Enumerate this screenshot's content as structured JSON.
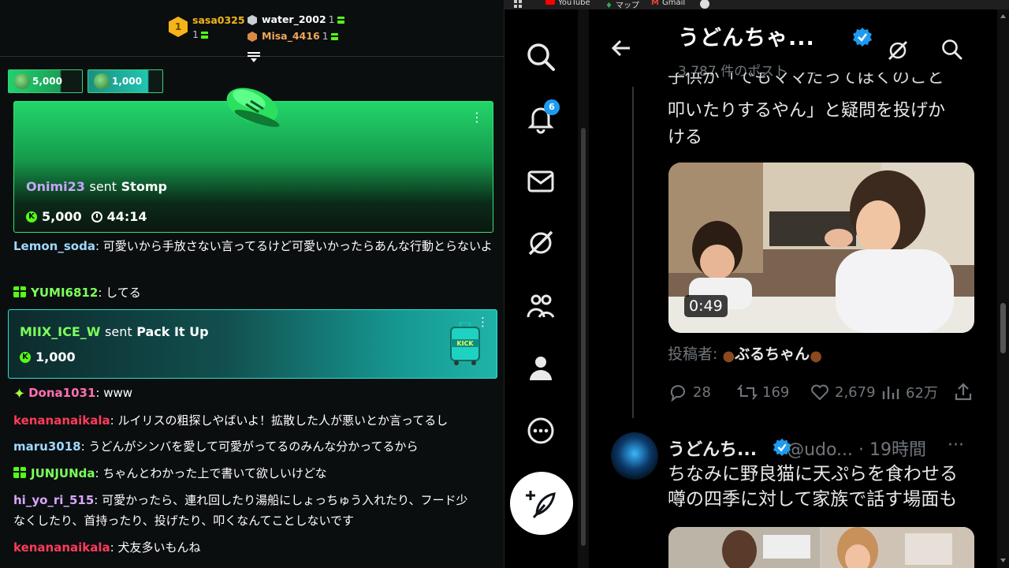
{
  "leaderboard": [
    {
      "rank": "1",
      "user": "sasa0325",
      "count": "1"
    },
    {
      "rank": "2",
      "user": "water_2002",
      "count": "1"
    },
    {
      "rank": "3",
      "user": "Misa_4416",
      "count": "1"
    }
  ],
  "pinned_gifts": [
    {
      "amount": "5,000"
    },
    {
      "amount": "1,000"
    }
  ],
  "stomp_card": {
    "user": "Onimi23",
    "verb": "sent",
    "gift": "Stomp",
    "amount": "5,000",
    "timer": "44:14"
  },
  "pack_card": {
    "user": "MIIX_ICE_W",
    "verb": "sent",
    "gift": "Pack It Up",
    "amount": "1,000"
  },
  "messages": [
    {
      "user": "Lemon_soda",
      "color": "#9fd8ff",
      "text": "可愛いから手放さない言ってるけど可愛いかったらあんな行動とらないよ",
      "text2": "ないよ"
    },
    {
      "user": "YUMI6812",
      "color": "#7cff5c",
      "text": "してる"
    },
    {
      "user": "Dona1031",
      "color": "#ff6fb0",
      "text": "www"
    },
    {
      "user": "kenananaikala",
      "color": "#ff3b5b",
      "text": "ルイリスの粗探しやばいよ！拡散した人が悪いとか言ってるし"
    },
    {
      "user": "maru3018",
      "color": "#9fd8ff",
      "text": "うどんがシンバを愛して可愛がってるのみんな分かってるから"
    },
    {
      "user": "JUNJUNda",
      "color": "#7cff5c",
      "text": "ちゃんとわかった上で書いて欲しいけどな"
    },
    {
      "user": "hi_yo_ri_515",
      "color": "#d9a6ff",
      "text": "可愛かったら、連れ回したり湯船にしょっちゅう入れたり、フード少",
      "text2": "なくしたり、首持ったり、投げたり、叩くなんてことしないです"
    },
    {
      "user": "kenananaikala",
      "color": "#ff3b5b",
      "text": "犬友多いもんね"
    }
  ],
  "bookmarks": [
    "YouTube",
    "マップ",
    "Gmail"
  ],
  "x_profile": {
    "name": "うどんちゃ...",
    "post_count": "3,787 件のポスト",
    "notifications": "6"
  },
  "tweet1": {
    "line0": "子供が「でもママだってぼくのこと",
    "line1": "叩いたりするやん」と疑問を投げか",
    "line2": "ける",
    "video_duration": "0:49",
    "poster_label": "投稿者:",
    "poster_name": "ぶるちゃん",
    "replies": "28",
    "reposts": "169",
    "likes": "2,679",
    "views": "62万"
  },
  "tweet2": {
    "name": "うどんち...",
    "handle": "@udo...",
    "time": "· 19時間",
    "line1": "ちなみに野良猫に天ぷらを食わせる",
    "line2": "噂の四季に対して家族で話す場面も"
  },
  "colors": {
    "kick_green": "#53fc18",
    "x_blue": "#1d9bf0"
  }
}
